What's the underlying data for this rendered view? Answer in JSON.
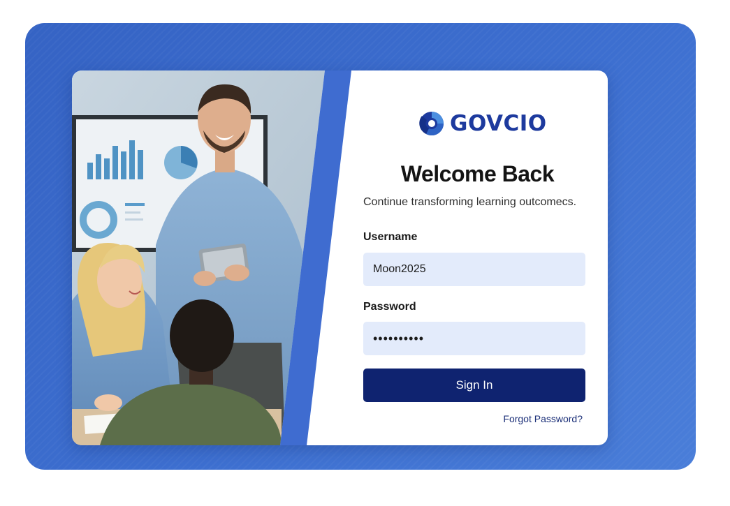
{
  "brand": {
    "name": "GOVCIO",
    "logo_icon": "govcio-swirl-logo"
  },
  "heading": {
    "title": "Welcome Back",
    "subtitle": "Continue transforming learning outcomecs."
  },
  "form": {
    "username_label": "Username",
    "username_value": "Moon2025",
    "password_label": "Password",
    "password_value": "••••••••••",
    "submit_label": "Sign In",
    "forgot_link": "Forgot Password?"
  },
  "colors": {
    "backdrop": "#3d6fd0",
    "brand_blue": "#1d3a9e",
    "input_fill": "#e3ebfb",
    "button_fill": "#0f2370",
    "accent_stripe": "#3f6cd0"
  },
  "hero_image": {
    "description_icon": "classroom-photo"
  }
}
